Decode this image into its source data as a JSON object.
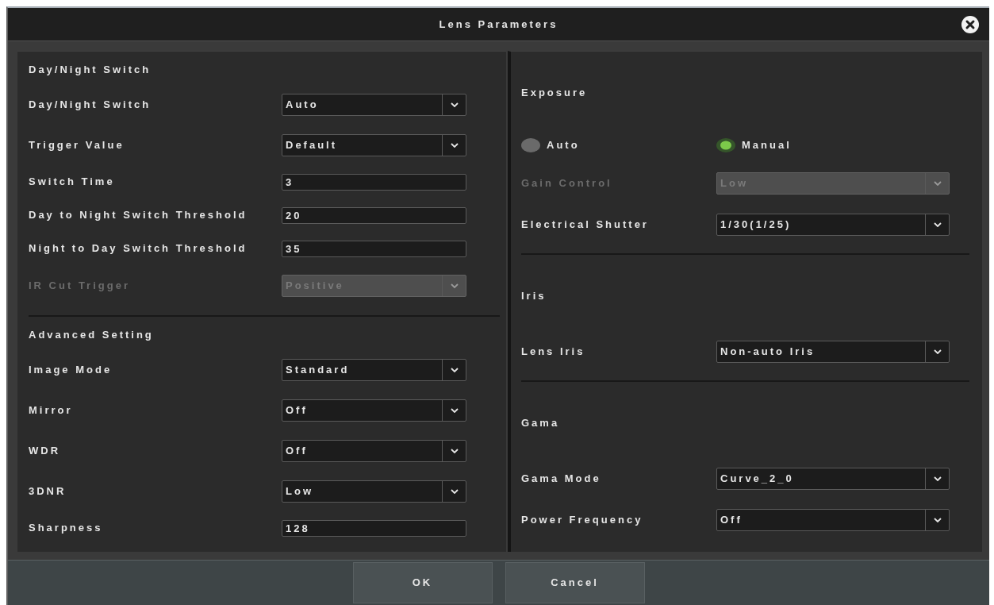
{
  "window": {
    "title": "Lens Parameters"
  },
  "left_panel": {
    "sections": [
      {
        "title": "Day/Night Switch",
        "fields": [
          {
            "kind": "select",
            "label": "Day/Night Switch",
            "value": "Auto",
            "disabled": false
          },
          {
            "kind": "select",
            "label": "Trigger Value",
            "value": "Default",
            "disabled": false
          },
          {
            "kind": "input",
            "label": "Switch Time",
            "value": "3",
            "disabled": false
          },
          {
            "kind": "input",
            "label": "Day to Night Switch Threshold",
            "value": "20",
            "disabled": false
          },
          {
            "kind": "input",
            "label": "Night to Day Switch Threshold",
            "value": "35",
            "disabled": false
          },
          {
            "kind": "select",
            "label": "IR Cut Trigger",
            "value": "Positive",
            "disabled": true
          }
        ]
      },
      {
        "title": "Advanced Setting",
        "fields": [
          {
            "kind": "select",
            "label": "Image Mode",
            "value": "Standard",
            "disabled": false
          },
          {
            "kind": "select",
            "label": "Mirror",
            "value": "Off",
            "disabled": false
          },
          {
            "kind": "select",
            "label": "WDR",
            "value": "Off",
            "disabled": false
          },
          {
            "kind": "select",
            "label": "3DNR",
            "value": "Low",
            "disabled": false
          },
          {
            "kind": "input",
            "label": "Sharpness",
            "value": "128",
            "disabled": false
          }
        ]
      }
    ]
  },
  "right_panel": {
    "sections": [
      {
        "title": "Exposure",
        "fields": [
          {
            "kind": "radios",
            "options": [
              {
                "label": "Auto",
                "selected": false
              },
              {
                "label": "Manual",
                "selected": true
              }
            ]
          },
          {
            "kind": "select",
            "label": "Gain Control",
            "value": "Low",
            "disabled": true
          },
          {
            "kind": "select",
            "label": "Electrical Shutter",
            "value": "1/30(1/25)",
            "disabled": false
          }
        ]
      },
      {
        "title": "Iris",
        "fields": [
          {
            "kind": "select",
            "label": "Lens Iris",
            "value": "Non-auto Iris",
            "disabled": false
          }
        ]
      },
      {
        "title": "Gama",
        "fields": [
          {
            "kind": "select",
            "label": "Gama Mode",
            "value": "Curve_2_0",
            "disabled": false
          },
          {
            "kind": "select",
            "label": "Power Frequency",
            "value": "Off",
            "disabled": false
          }
        ]
      }
    ]
  },
  "buttons": [
    {
      "label": "OK"
    },
    {
      "label": "Cancel"
    }
  ]
}
